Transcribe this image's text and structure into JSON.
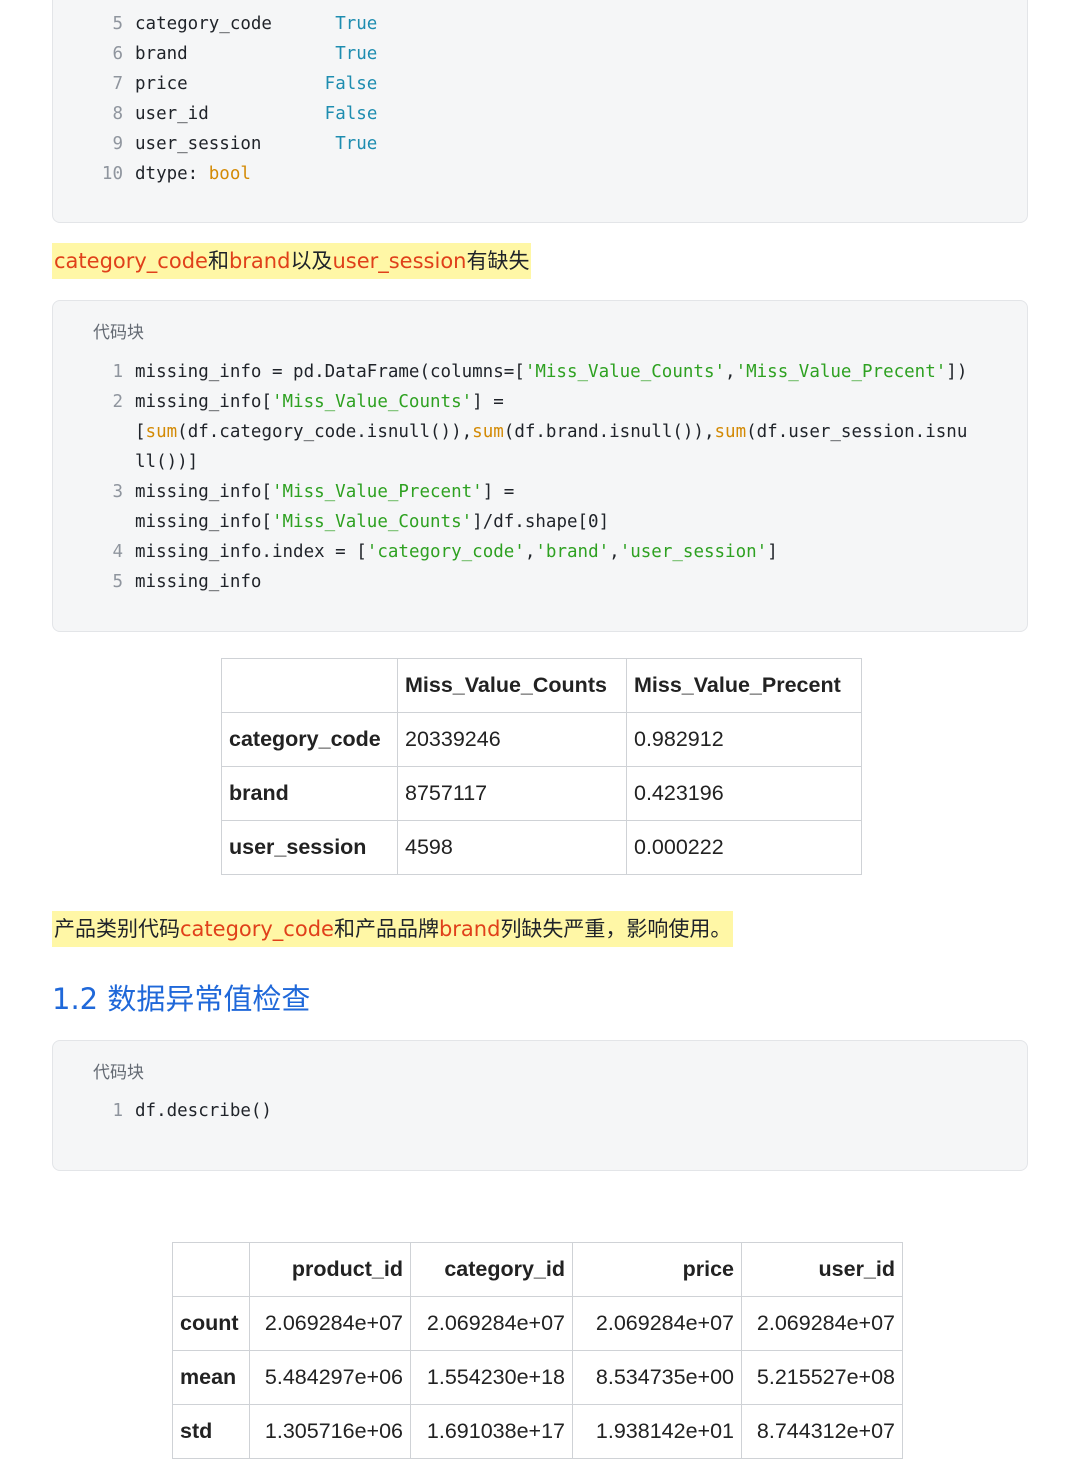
{
  "dtype_block": {
    "lines": [
      {
        "n": "5",
        "name": "category_code",
        "pad": "      ",
        "value": "True"
      },
      {
        "n": "6",
        "name": "brand",
        "pad": "              ",
        "value": "True"
      },
      {
        "n": "7",
        "name": "price",
        "pad": "             ",
        "value": "False"
      },
      {
        "n": "8",
        "name": "user_id",
        "pad": "           ",
        "value": "False"
      },
      {
        "n": "9",
        "name": "user_session",
        "pad": "       ",
        "value": "True"
      }
    ],
    "last_line": {
      "n": "10",
      "label": "dtype: ",
      "value": "bool"
    }
  },
  "note1": {
    "parts": [
      {
        "text": "category_code",
        "red": true
      },
      {
        "text": "和",
        "red": false
      },
      {
        "text": "brand",
        "red": true
      },
      {
        "text": "以及",
        "red": false
      },
      {
        "text": "user_session",
        "red": true
      },
      {
        "text": "有缺失",
        "red": false
      }
    ]
  },
  "code_block_1": {
    "title": "代码块",
    "lines": [
      {
        "n": "1",
        "segs": [
          [
            "",
            "missing_info = pd.DataFrame(columns=["
          ],
          [
            "str",
            "'Miss_Value_Counts'"
          ],
          [
            "",
            ","
          ],
          [
            "str",
            "'Miss_Value_Precent'"
          ],
          [
            "",
            "])"
          ]
        ]
      },
      {
        "n": "2",
        "segs": [
          [
            "",
            "missing_info["
          ],
          [
            "str",
            "'Miss_Value_Counts'"
          ],
          [
            "",
            "] ="
          ]
        ]
      },
      {
        "n": "",
        "segs": [
          [
            "",
            "["
          ],
          [
            "fn",
            "sum"
          ],
          [
            "",
            "(df.category_code.isnull()),"
          ],
          [
            "fn",
            "sum"
          ],
          [
            "",
            "(df.brand.isnull()),"
          ],
          [
            "fn",
            "sum"
          ],
          [
            "",
            "(df.user_session.isnu"
          ]
        ]
      },
      {
        "n": "",
        "segs": [
          [
            "",
            "ll())]"
          ]
        ]
      },
      {
        "n": "3",
        "segs": [
          [
            "",
            "missing_info["
          ],
          [
            "str",
            "'Miss_Value_Precent'"
          ],
          [
            "",
            "] ="
          ]
        ]
      },
      {
        "n": "",
        "segs": [
          [
            "",
            "missing_info["
          ],
          [
            "str",
            "'Miss_Value_Counts'"
          ],
          [
            "",
            "]/df.shape[0]"
          ]
        ]
      },
      {
        "n": "4",
        "segs": [
          [
            "",
            "missing_info.index = ["
          ],
          [
            "str",
            "'category_code'"
          ],
          [
            "",
            ","
          ],
          [
            "str",
            "'brand'"
          ],
          [
            "",
            ","
          ],
          [
            "str",
            "'user_session'"
          ],
          [
            "",
            "]"
          ]
        ]
      },
      {
        "n": "5",
        "segs": [
          [
            "",
            "missing_info"
          ]
        ]
      }
    ]
  },
  "missing_table": {
    "columns": [
      "",
      "Miss_Value_Counts",
      "Miss_Value_Precent"
    ],
    "rows": [
      {
        "index": "category_code",
        "counts": "20339246",
        "precent": "0.982912"
      },
      {
        "index": "brand",
        "counts": "8757117",
        "precent": "0.423196"
      },
      {
        "index": "user_session",
        "counts": "4598",
        "precent": "0.000222"
      }
    ]
  },
  "note2": {
    "parts": [
      {
        "text": "产品类别代码",
        "red": false
      },
      {
        "text": "category_code",
        "red": true
      },
      {
        "text": "和产品品牌",
        "red": false
      },
      {
        "text": "brand",
        "red": true
      },
      {
        "text": "列缺失严重，影响使用。",
        "red": false
      }
    ]
  },
  "section_heading": "1.2 数据异常值检查",
  "code_block_2": {
    "title": "代码块",
    "lines": [
      {
        "n": "1",
        "segs": [
          [
            "",
            "df.describe()"
          ]
        ]
      }
    ]
  },
  "describe_table": {
    "columns": [
      "",
      "product_id",
      "category_id",
      "price",
      "user_id"
    ],
    "rows": [
      {
        "index": "count",
        "values": [
          "2.069284e+07",
          "2.069284e+07",
          "2.069284e+07",
          "2.069284e+07"
        ]
      },
      {
        "index": "mean",
        "values": [
          "5.484297e+06",
          "1.554230e+18",
          "8.534735e+00",
          "5.215527e+08"
        ]
      },
      {
        "index": "std",
        "values": [
          "1.305716e+06",
          "1.691038e+17",
          "1.938142e+01",
          "8.744312e+07"
        ]
      }
    ]
  }
}
